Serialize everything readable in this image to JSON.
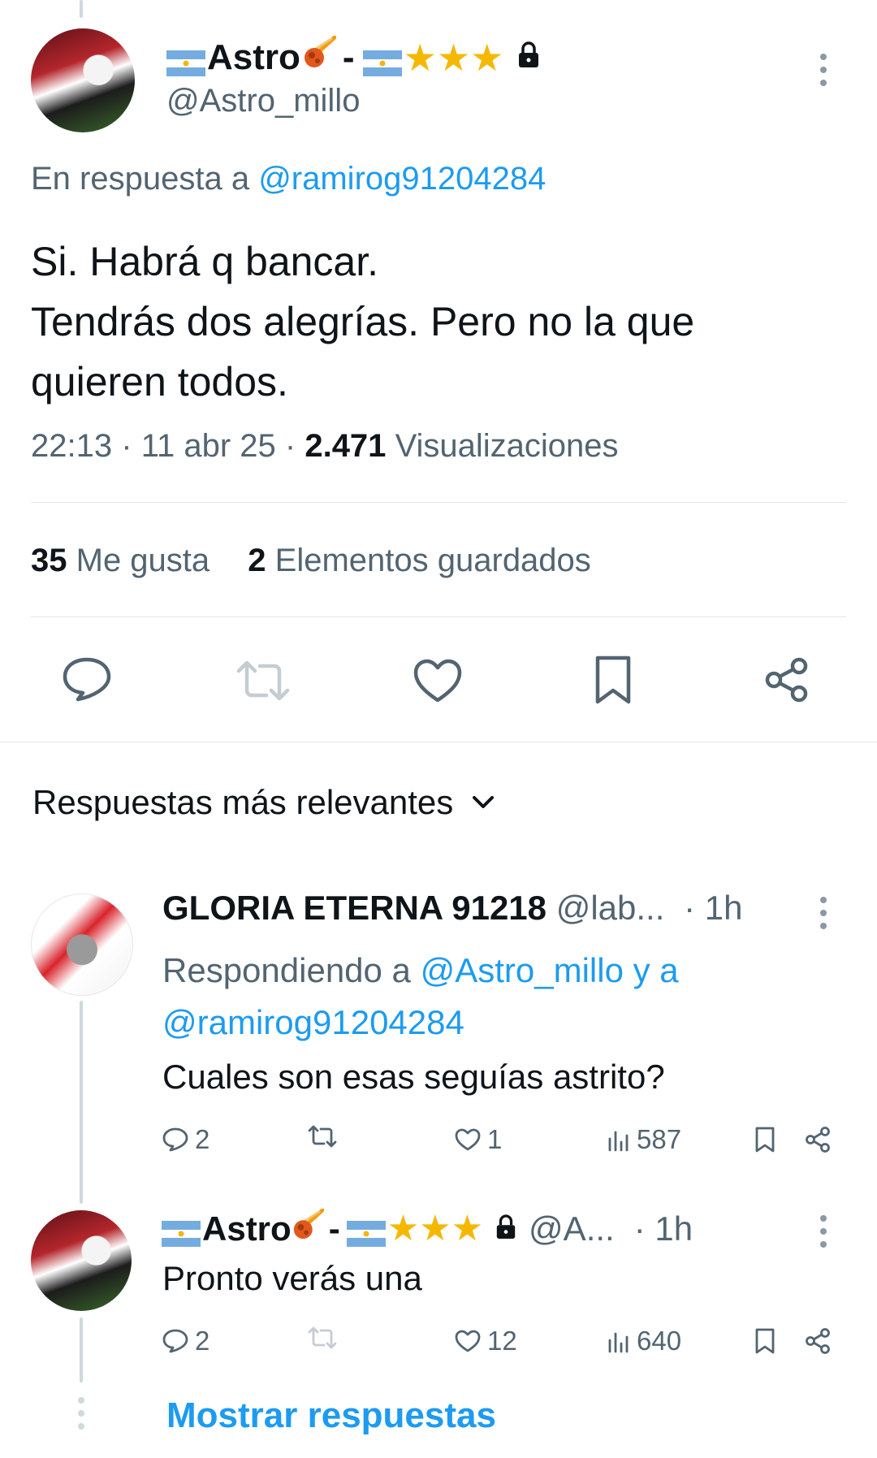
{
  "main_tweet": {
    "name_prefix_flag": "argentina-flag",
    "display_name": "Astro",
    "name_separator": "-",
    "stars": [
      "★",
      "★",
      "★"
    ],
    "protected": "lock-icon",
    "handle": "@Astro_millo",
    "reply_to_label": "En respuesta a",
    "reply_to_handle": "@ramirog91204284",
    "text_line1": "Si. Habrá q bancar.",
    "text_line2": "Tendrás dos alegrías. Pero no la que",
    "text_line3": "quieren todos.",
    "time": "22:13",
    "date": "11 abr 25",
    "dot": "·",
    "views_count": "2.471",
    "views_label": "Visualizaciones",
    "likes_count": "35",
    "likes_label": "Me gusta",
    "bookmarks_count": "2",
    "bookmarks_label": "Elementos guardados"
  },
  "replies_header": {
    "label": "Respuestas más relevantes"
  },
  "reply1": {
    "display_name": "GLORIA ETERNA 91218",
    "handle": "@lab...",
    "time": "· 1h",
    "replying_label": "Respondiendo a",
    "replying_handles": "@Astro_millo y a",
    "replying_handle2": "@ramirog91204284",
    "text": "Cuales son esas seguías astrito?",
    "replies": "2",
    "likes": "1",
    "views": "587"
  },
  "reply2": {
    "display_name": "Astro",
    "name_separator": "-",
    "handle": "@A...",
    "time": "· 1h",
    "text": "Pronto verás una",
    "replies": "2",
    "likes": "12",
    "views": "640"
  },
  "show_replies": "Mostrar respuestas",
  "colors": {
    "accent": "#1d9bf0",
    "muted": "#536471",
    "text": "#0f1419",
    "star": "#f5b800"
  }
}
